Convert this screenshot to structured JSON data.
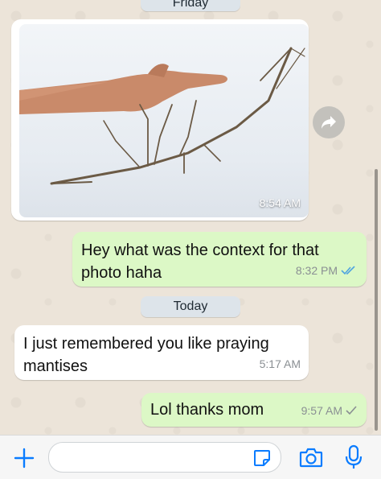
{
  "colors": {
    "accent": "#0a7cff",
    "outgoing_bubble": "#dcf8c6",
    "incoming_bubble": "#ffffff",
    "date_pill": "#dde4ea",
    "chat_background": "#ece4d9",
    "read_receipt": "#4fa3e0"
  },
  "date_separators": {
    "friday": "Friday",
    "today": "Today"
  },
  "messages": {
    "photo": {
      "type": "image",
      "content": "hand holding a stick insect",
      "time": "8:54 AM"
    },
    "context_question": {
      "line1": "Hey what was the context for that",
      "line2": "photo haha",
      "time": "8:32 PM",
      "status_icon": "double-check-icon"
    },
    "remembered": {
      "line1": "I just remembered you like praying",
      "line2": "mantises",
      "time": "5:17 AM"
    },
    "thanks": {
      "text": "Lol thanks mom",
      "time": "9:57 AM",
      "status_icon": "single-check-icon"
    }
  },
  "composer": {
    "placeholder": "",
    "icons": [
      "plus-icon",
      "sticker-icon",
      "camera-icon",
      "microphone-icon"
    ]
  },
  "forward_icon": "forward-icon"
}
